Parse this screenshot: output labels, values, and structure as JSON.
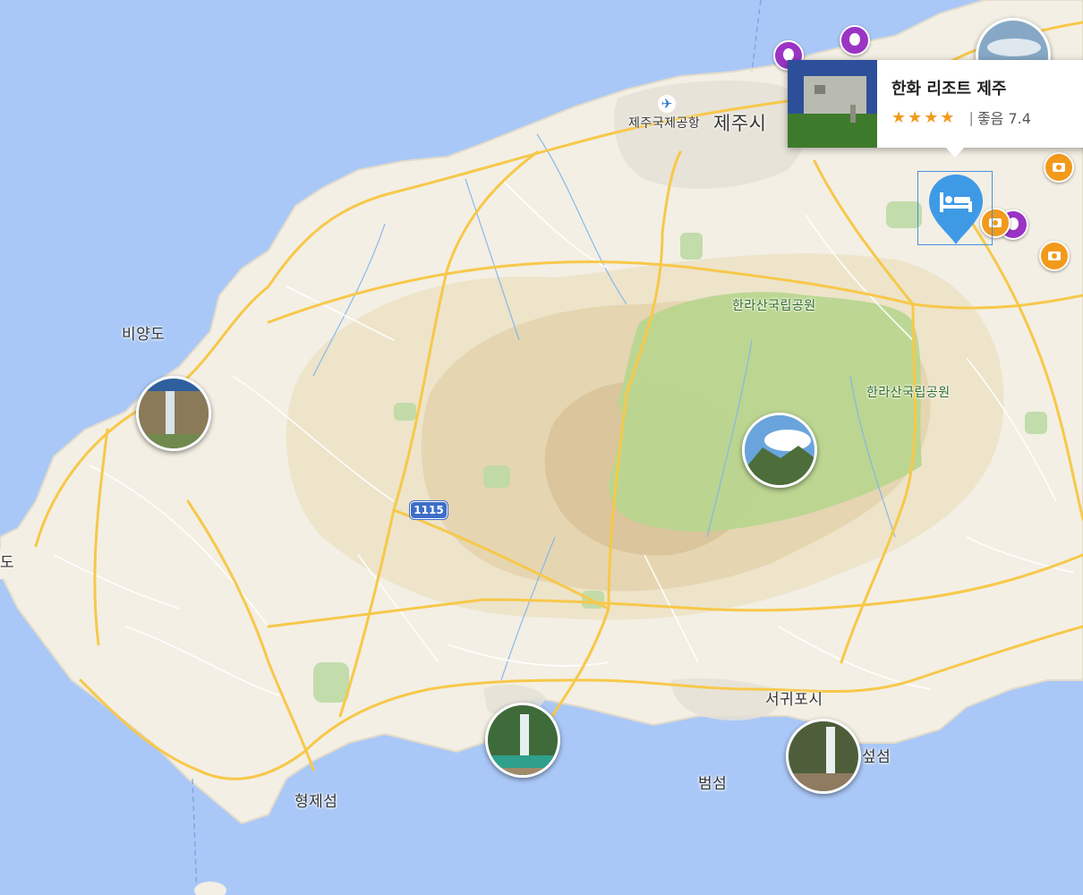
{
  "map": {
    "labels": {
      "jeju_city": "제주시",
      "jeju_airport": "제주국제공항",
      "biyangdo": "비양도",
      "hallasan_park_1": "한라산국립공원",
      "hallasan_park_2": "한라산국립공원",
      "seogwipo": "서귀포시",
      "beomseom": "범섬",
      "hyeongjeseom": "형제섬",
      "munseom_partial": "섶섬",
      "left_edge_partial": "도"
    },
    "road_shield": "1115",
    "colors": {
      "water": "#aac8f7",
      "land": "#f3efe4",
      "park": "#b9d68f",
      "road": "#f7c84a",
      "poi_purple": "#9b33c4",
      "poi_orange": "#f29a1b",
      "hotel_pin": "#3f9ae6"
    },
    "markers": {
      "photo_count": 6,
      "purple_count": 3,
      "orange_count": 3
    }
  },
  "popup": {
    "name": "한화 리조트 제주",
    "stars": "★★★★",
    "star_count": 4,
    "separator": "|",
    "rating_text": "좋음 7.4"
  },
  "icons": {
    "hotel": "hotel-bed-icon",
    "airport": "airport-icon",
    "camera": "camera-icon",
    "balloon": "balloon-icon"
  }
}
